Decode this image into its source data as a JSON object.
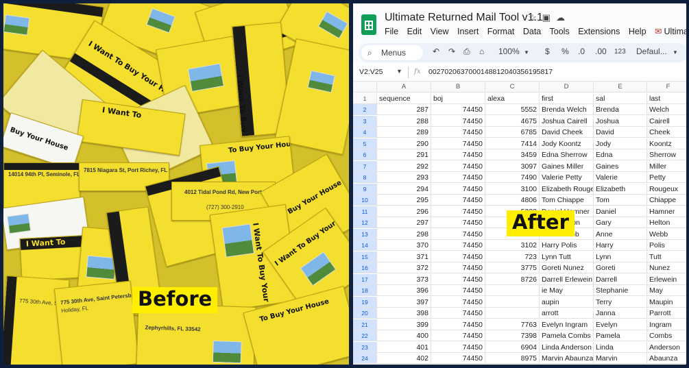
{
  "labels": {
    "before": "Before",
    "after": "After"
  },
  "mail_cards": [
    "I Want To Buy Your House",
    "I Want To Buy Your House",
    "I Want To Buy Your House",
    "To Buy Your House",
    "I Want To",
    "I Want To",
    "Buy Your House",
    "14014 94th Pl, Seminole, FL 33776",
    "7815 Niagara St, Port Richey, FL",
    "4012 Tidal Pond Rd, New Port Richey, FL 34652",
    "(727) 300-2910",
    "775 30th Ave, Saint Petersburg, FL",
    "Holiday, FL",
    "Zephyrhills, FL 33542"
  ],
  "spreadsheet": {
    "title": "Ultimate Returned Mail Tool v1.1",
    "menu": [
      "File",
      "Edit",
      "View",
      "Insert",
      "Format",
      "Data",
      "Tools",
      "Extensions",
      "Help"
    ],
    "menu_extension": "Ultimate Re",
    "toolbar": {
      "search": "Menus",
      "zoom": "100%",
      "currency": "$",
      "percent": "%",
      "dec_less": ".0",
      "dec_more": ".00",
      "number_format": "123",
      "font": "Defaul..."
    },
    "formula_bar": {
      "range": "V2:V25",
      "fx": "fx",
      "value": "0027020637000148812040356195817"
    },
    "column_letters": [
      "A",
      "B",
      "C",
      "D",
      "E",
      "F"
    ],
    "headers": [
      "sequence",
      "boj",
      "alexa",
      "first",
      "sal",
      "last"
    ],
    "rows": [
      [
        "287",
        "74450",
        "5552",
        "Brenda Welch",
        "Brenda",
        "Welch"
      ],
      [
        "288",
        "74450",
        "4675",
        "Joshua Cairell",
        "Joshua",
        "Cairell"
      ],
      [
        "289",
        "74450",
        "6785",
        "David Cheek",
        "David",
        "Cheek"
      ],
      [
        "290",
        "74450",
        "7414",
        "Jody Koontz",
        "Jody",
        "Koontz"
      ],
      [
        "291",
        "74450",
        "3459",
        "Edna Sherrow",
        "Edna",
        "Sherrow"
      ],
      [
        "292",
        "74450",
        "3097",
        "Gaines Miller",
        "Gaines",
        "Miller"
      ],
      [
        "293",
        "74450",
        "7490",
        "Valerie Petty",
        "Valerie",
        "Petty"
      ],
      [
        "294",
        "74450",
        "3100",
        "Elizabeth Rouge",
        "Elizabeth",
        "Rougeux"
      ],
      [
        "295",
        "74450",
        "4806",
        "Tom Chiappe",
        "Tom",
        "Chiappe"
      ],
      [
        "296",
        "74450",
        "5322",
        "Daniel Hamner",
        "Daniel",
        "Hamner"
      ],
      [
        "297",
        "74450",
        "7999",
        "Gary Helton",
        "Gary",
        "Helton"
      ],
      [
        "298",
        "74450",
        "2782",
        "Anne Webb",
        "Anne",
        "Webb"
      ],
      [
        "370",
        "74450",
        "3102",
        "Harry Polis",
        "Harry",
        "Polis"
      ],
      [
        "371",
        "74450",
        "723",
        "Lynn Tutt",
        "Lynn",
        "Tutt"
      ],
      [
        "372",
        "74450",
        "3775",
        "Goreti Nunez",
        "Goreti",
        "Nunez"
      ],
      [
        "373",
        "74450",
        "8726",
        "Darrell Erlewein",
        "Darrell",
        "Erlewein"
      ],
      [
        "396",
        "74450",
        "",
        "ie May",
        "Stephanie",
        "May"
      ],
      [
        "397",
        "74450",
        "",
        "aupin",
        "Terry",
        "Maupin"
      ],
      [
        "398",
        "74450",
        "",
        "arrott",
        "Janna",
        "Parrott"
      ],
      [
        "399",
        "74450",
        "7763",
        "Evelyn Ingram",
        "Evelyn",
        "Ingram"
      ],
      [
        "400",
        "74450",
        "7398",
        "Pamela Combs",
        "Pamela",
        "Combs"
      ],
      [
        "401",
        "74450",
        "6904",
        "Linda Anderson",
        "Linda",
        "Anderson"
      ],
      [
        "402",
        "74450",
        "8975",
        "Marvin Abaunza",
        "Marvin",
        "Abaunza"
      ]
    ]
  },
  "colors": {
    "card_yellow": "#f4de2e",
    "label_yellow": "#ffee00",
    "sheets_green": "#0f9d58",
    "frame": "#10203f"
  }
}
